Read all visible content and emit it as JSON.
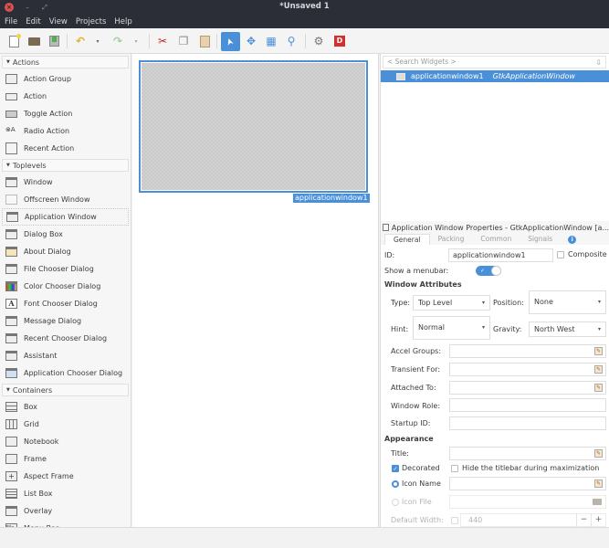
{
  "window": {
    "title": "*Unsaved 1",
    "close_glyph": "×",
    "minimize_glyph": "–",
    "maximize_glyph": "⤢"
  },
  "menubar": [
    "File",
    "Edit",
    "View",
    "Projects",
    "Help"
  ],
  "toolbar": {
    "buttons": [
      {
        "name": "new-icon",
        "glyph": "📄"
      },
      {
        "name": "open-icon",
        "glyph": "📂"
      },
      {
        "name": "save-icon",
        "glyph": "💾"
      },
      {
        "name": "undo-icon",
        "glyph": "↶"
      },
      {
        "name": "redo-icon",
        "glyph": "↷"
      },
      {
        "name": "cut-icon",
        "glyph": "✂"
      },
      {
        "name": "copy-icon",
        "glyph": "❐"
      },
      {
        "name": "paste-icon",
        "glyph": "📋"
      },
      {
        "name": "pointer-icon",
        "glyph": "➤"
      },
      {
        "name": "drag-resize-icon",
        "glyph": "✥"
      },
      {
        "name": "margin-edit-icon",
        "glyph": "▦"
      },
      {
        "name": "align-edit-icon",
        "glyph": "⚲"
      },
      {
        "name": "preferences-icon",
        "glyph": "⚙"
      },
      {
        "name": "devhelp-icon",
        "glyph": "D"
      }
    ],
    "dropdown_glyph": "▾"
  },
  "palette": {
    "sections": [
      {
        "title": "Actions",
        "items": [
          "Action Group",
          "Action",
          "Toggle Action",
          "Radio Action",
          "Recent Action"
        ]
      },
      {
        "title": "Toplevels",
        "items": [
          "Window",
          "Offscreen Window",
          "Application Window",
          "Dialog Box",
          "About Dialog",
          "File Chooser Dialog",
          "Color Chooser Dialog",
          "Font Chooser Dialog",
          "Message Dialog",
          "Recent Chooser Dialog",
          "Assistant",
          "Application Chooser Dialog"
        ]
      },
      {
        "title": "Containers",
        "items": [
          "Box",
          "Grid",
          "Notebook",
          "Frame",
          "Aspect Frame",
          "List Box",
          "Overlay",
          "Menu Bar"
        ]
      }
    ],
    "selected": "Application Window"
  },
  "canvas": {
    "widget_label": "applicationwindow1"
  },
  "inspector": {
    "search_placeholder": "< Search Widgets >",
    "search_icon": "⇩",
    "tree": [
      {
        "name": "applicationwindow1",
        "class": "GtkApplicationWindow",
        "selected": true
      }
    ]
  },
  "properties": {
    "title": "Application Window Properties - GtkApplicationWindow [a...",
    "tabs": [
      {
        "label": "General",
        "active": true
      },
      {
        "label": "Packing",
        "active": false
      },
      {
        "label": "Common",
        "active": false
      },
      {
        "label": "Signals",
        "active": false
      }
    ],
    "info_glyph": "i",
    "id_label": "ID:",
    "id_value": "applicationwindow1",
    "composite_label": "Composite",
    "composite_checked": false,
    "menubar_label": "Show a menubar:",
    "menubar_on": true,
    "window_attributes_label": "Window Attributes",
    "type_label": "Type:",
    "type_value": "Top Level",
    "position_label": "Position:",
    "position_value": "None",
    "hint_label": "Hint:",
    "hint_value": "Normal",
    "gravity_label": "Gravity:",
    "gravity_value": "North West",
    "accel_groups_label": "Accel Groups:",
    "transient_for_label": "Transient For:",
    "attached_to_label": "Attached To:",
    "window_role_label": "Window Role:",
    "startup_id_label": "Startup ID:",
    "appearance_label": "Appearance",
    "title_label": "Title:",
    "decorated_label": "Decorated",
    "decorated_checked": true,
    "hide_titlebar_label": "Hide the titlebar during maximization",
    "hide_titlebar_checked": false,
    "icon_name_label": "Icon Name",
    "icon_file_label": "Icon File",
    "default_width_label": "Default Width:",
    "default_width_value": "440",
    "minus": "−",
    "plus": "+",
    "check_glyph": "✓",
    "arrow_glyph": "▾",
    "edit_glyph": "✎",
    "folder_glyph": "▬"
  }
}
